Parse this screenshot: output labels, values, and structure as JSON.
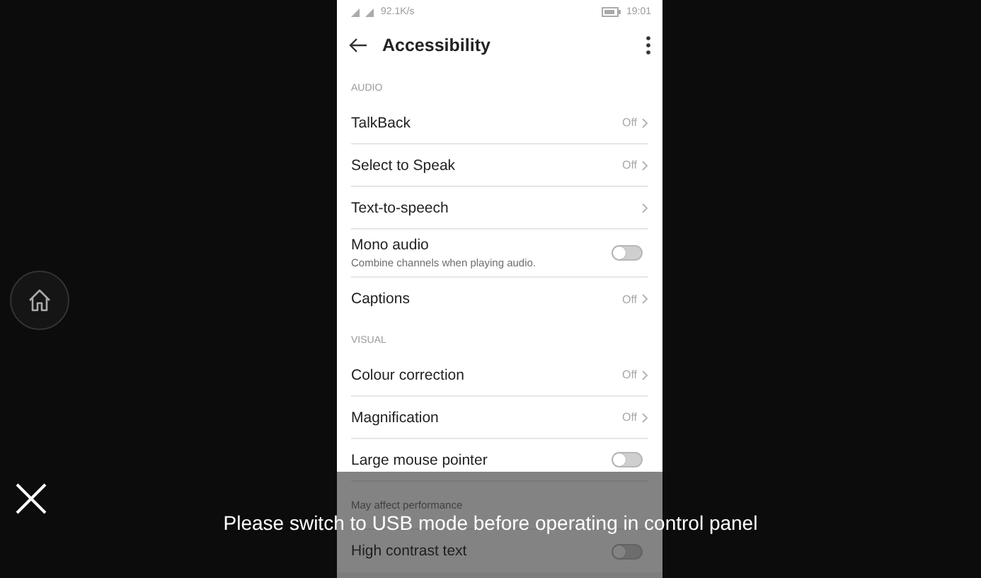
{
  "status_bar": {
    "speed": "92.1K/s",
    "time": "19:01"
  },
  "app_bar": {
    "title": "Accessibility"
  },
  "sections": [
    {
      "header": "AUDIO",
      "items": [
        {
          "kind": "nav",
          "title": "TalkBack",
          "value": "Off"
        },
        {
          "kind": "nav",
          "title": "Select to Speak",
          "value": "Off"
        },
        {
          "kind": "nav",
          "title": "Text-to-speech"
        },
        {
          "kind": "toggle",
          "title": "Mono audio",
          "subtitle": "Combine channels when playing audio.",
          "on": false
        },
        {
          "kind": "nav",
          "title": "Captions",
          "value": "Off"
        }
      ]
    },
    {
      "header": "VISUAL",
      "items": [
        {
          "kind": "nav",
          "title": "Colour correction",
          "value": "Off"
        },
        {
          "kind": "nav",
          "title": "Magnification",
          "value": "Off"
        },
        {
          "kind": "toggle",
          "title": "Large mouse pointer",
          "on": false
        },
        {
          "kind": "text",
          "subtitle": "May affect performance"
        },
        {
          "kind": "toggle",
          "title": "High contrast text",
          "on": false
        }
      ]
    }
  ],
  "toast": {
    "message": "Please switch to USB mode before operating in control panel"
  }
}
